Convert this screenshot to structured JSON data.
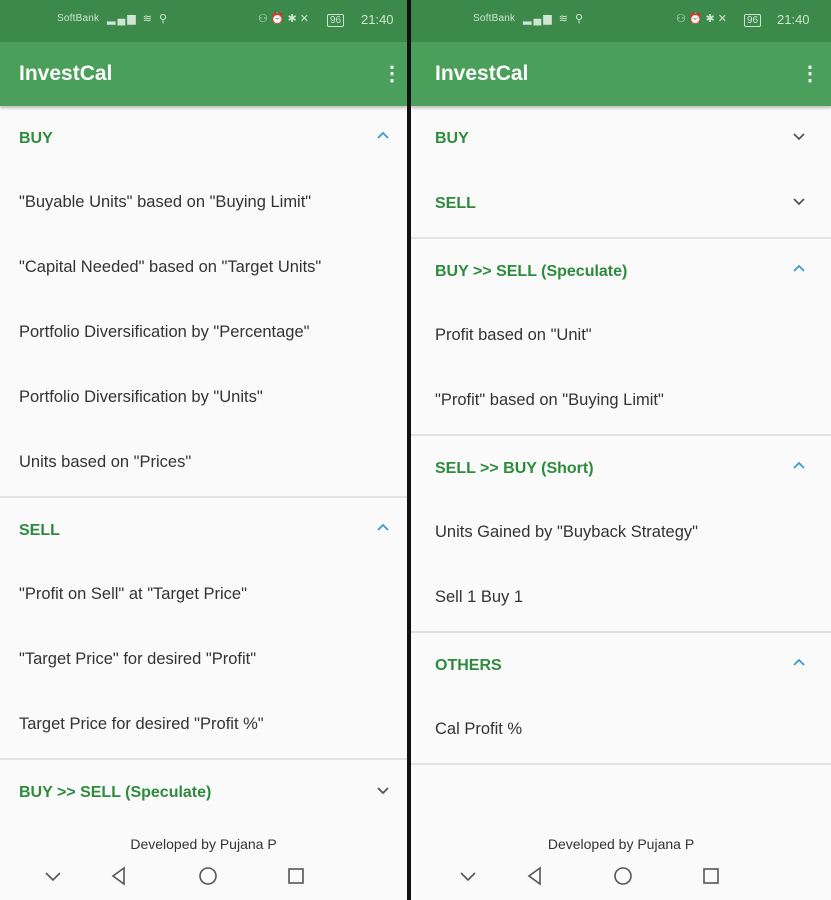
{
  "status_bar": {
    "carrier": "SoftBank",
    "battery": "96",
    "time": "21:40"
  },
  "app": {
    "title": "InvestCal"
  },
  "left_screen": {
    "sections": [
      {
        "title": "BUY",
        "expanded": true,
        "items": [
          "\"Buyable Units\" based on \"Buying Limit\"",
          "\"Capital Needed\" based on \"Target Units\"",
          "Portfolio Diversification by \"Percentage\"",
          "Portfolio Diversification by \"Units\"",
          "Units based on \"Prices\""
        ]
      },
      {
        "title": "SELL",
        "expanded": true,
        "items": [
          "\"Profit on Sell\" at \"Target Price\"",
          "\"Target Price\" for desired \"Profit\"",
          "Target Price for desired \"Profit %\""
        ]
      },
      {
        "title": "BUY >> SELL (Speculate)",
        "expanded": false,
        "items": []
      }
    ],
    "footer": "Developed by Pujana P"
  },
  "right_screen": {
    "sections": [
      {
        "title": "BUY",
        "expanded": false,
        "items": []
      },
      {
        "title": "SELL",
        "expanded": false,
        "items": []
      },
      {
        "title": "BUY >> SELL (Speculate)",
        "expanded": true,
        "items": [
          "Profit based on \"Unit\"",
          "\"Profit\" based on \"Buying Limit\""
        ]
      },
      {
        "title": "SELL >> BUY (Short)",
        "expanded": true,
        "items": [
          "Units Gained by \"Buyback Strategy\"",
          "Sell 1 Buy 1"
        ]
      },
      {
        "title": "OTHERS",
        "expanded": true,
        "items": [
          "Cal Profit %"
        ]
      }
    ],
    "footer": "Developed by Pujana P"
  },
  "icons": {
    "expanded": "chevron-up-icon",
    "collapsed": "chevron-down-icon",
    "menu": "more-vert-icon",
    "nav": [
      "hide-nav-icon",
      "back-icon",
      "home-icon",
      "recents-icon"
    ]
  },
  "colors": {
    "status_bar": "#3c8a4a",
    "app_bar": "#4aa05a",
    "section_title": "#2e8b3e",
    "chevron_up": "#3a9ad9",
    "chevron_down": "#555555"
  }
}
